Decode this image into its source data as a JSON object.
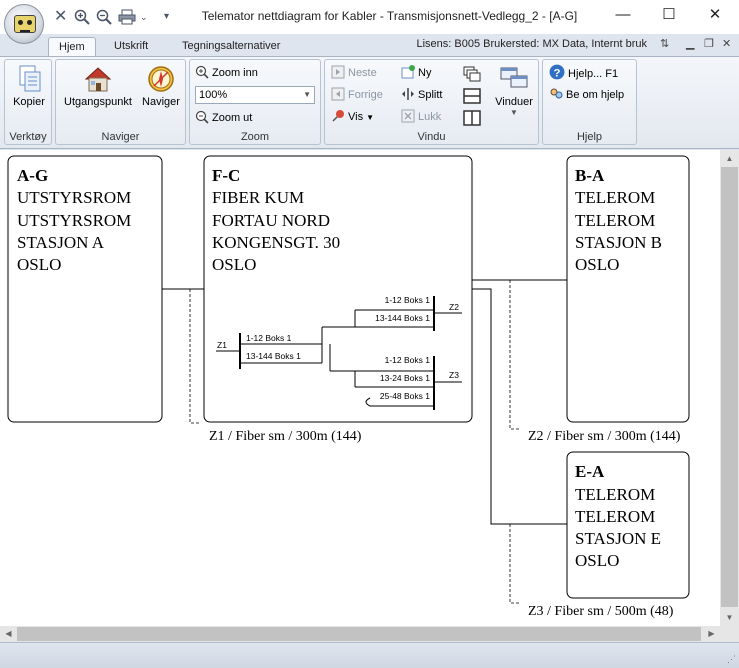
{
  "titlebar": {
    "title": "Telemator nettdiagram for Kabler - Transmisjonsnett-Vedlegg_2 - [A-G]",
    "qat_icons": [
      "close-x-icon",
      "zoom-in-icon",
      "zoom-out-icon",
      "print-icon",
      "dropdown-icon",
      "customize-icon"
    ],
    "window_controls": [
      "minimize-icon",
      "maximize-icon",
      "close-icon"
    ]
  },
  "tabs": [
    {
      "label": "Hjem",
      "active": true
    },
    {
      "label": "Utskrift",
      "active": false
    },
    {
      "label": "Tegningsalternativer",
      "active": false
    }
  ],
  "license": "Lisens: B005 Brukersted: MX Data, Internt bruk",
  "ribbon": {
    "verktoy": {
      "label": "Verktøy",
      "kopier": "Kopier"
    },
    "naviger": {
      "label": "Naviger",
      "utgangspunkt": "Utgangspunkt",
      "naviger": "Naviger"
    },
    "zoom": {
      "label": "Zoom",
      "zoom_inn": "Zoom inn",
      "zoom_value": "100%",
      "zoom_ut": "Zoom ut"
    },
    "vindu": {
      "label": "Vindu",
      "neste": "Neste",
      "forrige": "Forrige",
      "vis": "Vis",
      "ny": "Ny",
      "splitt": "Splitt",
      "lukk": "Lukk",
      "vinduer": "Vinduer"
    },
    "hjelp": {
      "label": "Hjelp",
      "hjelp": "Hjelp... F1",
      "be_om_hjelp": "Be om hjelp"
    }
  },
  "diagram": {
    "boxes": [
      {
        "id": "ag",
        "code": "A-G",
        "lines": [
          "UTSTYRSROM",
          "UTSTYRSROM",
          "STASJON A",
          "OSLO"
        ]
      },
      {
        "id": "fc",
        "code": "F-C",
        "lines": [
          "FIBER KUM",
          "FORTAU NORD",
          "KONGENSGT. 30",
          "OSLO"
        ]
      },
      {
        "id": "ba",
        "code": "B-A",
        "lines": [
          "TELEROM",
          "TELEROM",
          "STASJON B",
          "OSLO"
        ]
      },
      {
        "id": "ea",
        "code": "E-A",
        "lines": [
          "TELEROM",
          "TELEROM",
          "STASJON E",
          "OSLO"
        ]
      }
    ],
    "cables": [
      {
        "id": "z1",
        "label": "Z1 / Fiber sm / 300m (144)"
      },
      {
        "id": "z2",
        "label": "Z2 / Fiber sm / 300m (144)"
      },
      {
        "id": "z3",
        "label": "Z3 / Fiber sm / 500m (48)"
      }
    ],
    "terminations": {
      "z1": {
        "name": "Z1",
        "rows": [
          "1-12 Boks 1",
          "13-144 Boks 1"
        ]
      },
      "z2": {
        "name": "Z2",
        "rows": [
          "1-12 Boks 1",
          "13-144 Boks 1"
        ]
      },
      "z3": {
        "name": "Z3",
        "rows": [
          "1-12 Boks 1",
          "13-24 Boks 1",
          "25-48 Boks 1"
        ]
      }
    }
  }
}
